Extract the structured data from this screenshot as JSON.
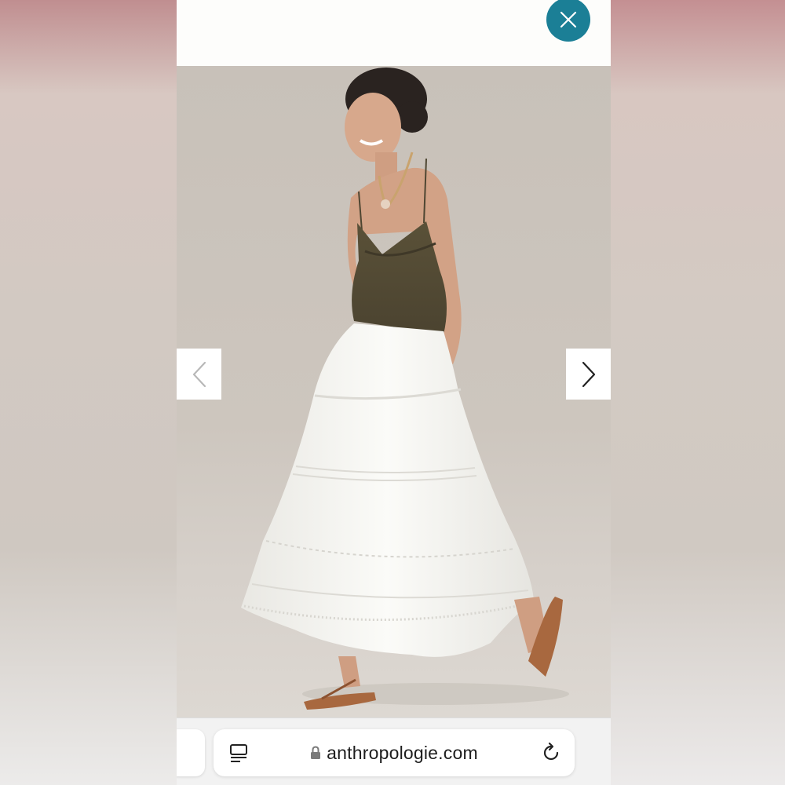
{
  "overlay": {
    "close_icon": "close-icon",
    "accent_color": "#1b7f96"
  },
  "gallery": {
    "image_subject": "Model wearing olive cami top with white tiered maxi skirt and brown sandals",
    "prev_icon": "chevron-left-icon",
    "next_icon": "chevron-right-icon"
  },
  "browser": {
    "url": "anthropologie.com",
    "reader_icon": "reader-mode-icon",
    "lock_icon": "lock-icon",
    "reload_icon": "reload-icon"
  }
}
